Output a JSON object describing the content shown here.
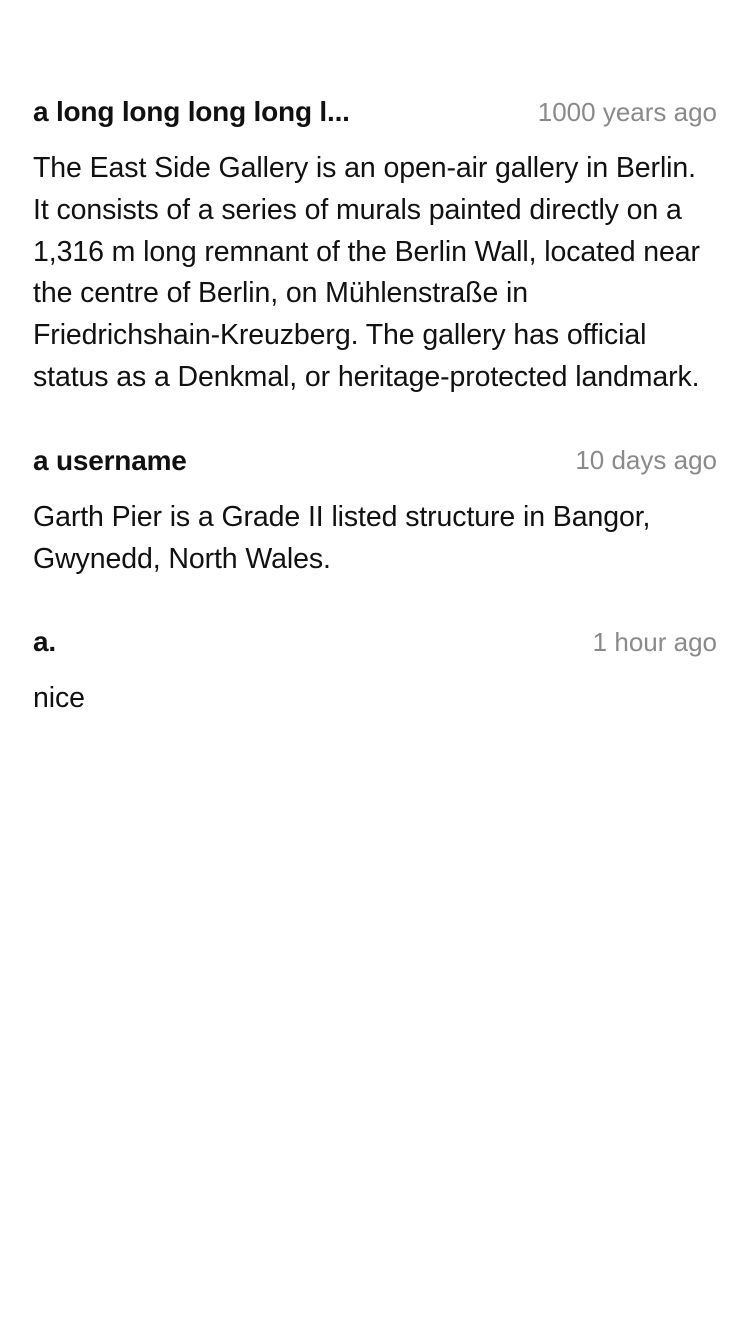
{
  "comments": [
    {
      "username": "a long long long long l...",
      "timestamp": "1000 years ago",
      "body": "The East Side Gallery is an open-air gallery in Berlin. It consists of a series of murals painted directly on a 1,316 m long remnant of the Berlin Wall, located near the centre of Berlin, on Mühlenstraße in Friedrichshain-Kreuzberg. The gallery has official status as a Denkmal, or heritage-protected landmark."
    },
    {
      "username": "a username",
      "timestamp": "10 days ago",
      "body": "Garth Pier is a Grade II listed structure in Bangor, Gwynedd, North Wales."
    },
    {
      "username": "a.",
      "timestamp": "1 hour ago",
      "body": "nice"
    }
  ]
}
